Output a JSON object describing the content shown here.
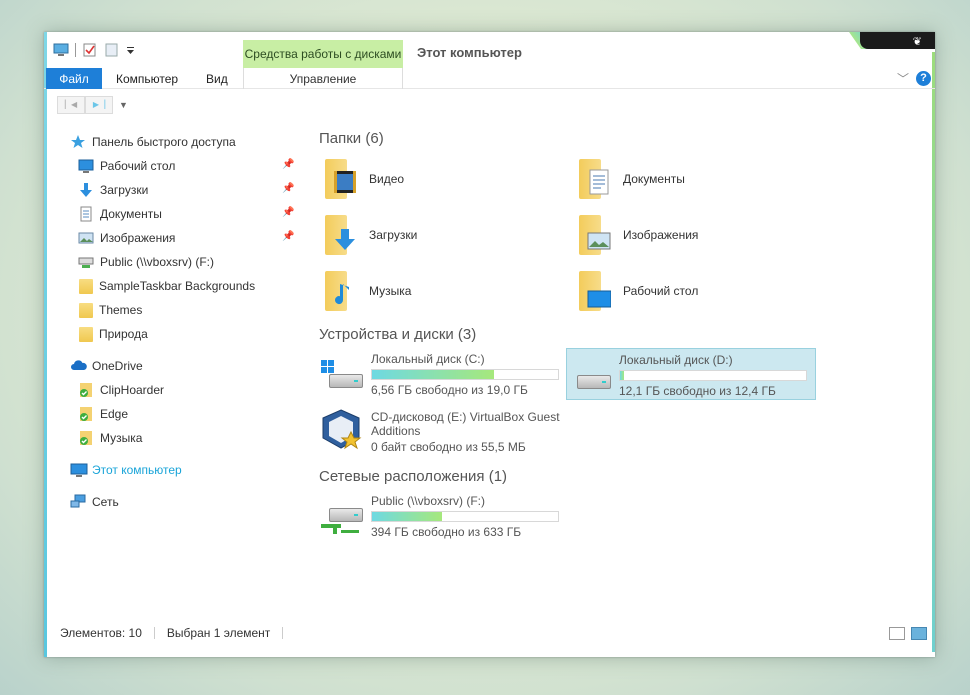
{
  "window": {
    "title": "Этот компьютер",
    "tool_tab": "Средства работы с дисками",
    "tool_subtab": "Управление",
    "tabs": {
      "file": "Файл",
      "computer": "Компьютер",
      "view": "Вид"
    },
    "help": "?"
  },
  "sidebar": {
    "quick_access": "Панель быстрого доступа",
    "pinned": [
      {
        "label": "Рабочий стол",
        "icon": "desktop-icon"
      },
      {
        "label": "Загрузки",
        "icon": "download-icon"
      },
      {
        "label": "Документы",
        "icon": "document-icon"
      },
      {
        "label": "Изображения",
        "icon": "image-icon"
      }
    ],
    "others": [
      {
        "label": "Public (\\\\vboxsrv) (F:)",
        "icon": "network-drive-icon"
      },
      {
        "label": "SampleTaskbar Backgrounds",
        "icon": "folder-icon"
      },
      {
        "label": "Themes",
        "icon": "folder-icon"
      },
      {
        "label": "Природа",
        "icon": "folder-icon"
      }
    ],
    "onedrive": "OneDrive",
    "onedrive_items": [
      "ClipHoarder",
      "Edge",
      "Музыка"
    ],
    "this_pc": "Этот компьютер",
    "network": "Сеть"
  },
  "content": {
    "folders_header": "Папки (6)",
    "folders": [
      {
        "name": "Видео",
        "icon": "video-folder-icon"
      },
      {
        "name": "Документы",
        "icon": "documents-folder-icon"
      },
      {
        "name": "Загрузки",
        "icon": "downloads-folder-icon"
      },
      {
        "name": "Изображения",
        "icon": "pictures-folder-icon"
      },
      {
        "name": "Музыка",
        "icon": "music-folder-icon"
      },
      {
        "name": "Рабочий стол",
        "icon": "desktop-folder-icon"
      }
    ],
    "devices_header": "Устройства и диски (3)",
    "drives": [
      {
        "name": "Локальный диск (C:)",
        "free": "6,56 ГБ свободно из 19,0 ГБ",
        "used": 0.655
      },
      {
        "name": "Локальный диск (D:)",
        "free": "12,1 ГБ свободно из 12,4 ГБ",
        "used": 0.024
      },
      {
        "name": "CD-дисковод (E:) VirtualBox Guest Additions",
        "free": "0 байт свободно из 55,5 МБ"
      }
    ],
    "network_header": "Сетевые расположения (1)",
    "network": [
      {
        "name": "Public (\\\\vboxsrv) (F:)",
        "free": "394 ГБ свободно из 633 ГБ",
        "used": 0.378
      }
    ]
  },
  "status": {
    "items": "Элементов: 10",
    "selected": "Выбран 1 элемент"
  }
}
